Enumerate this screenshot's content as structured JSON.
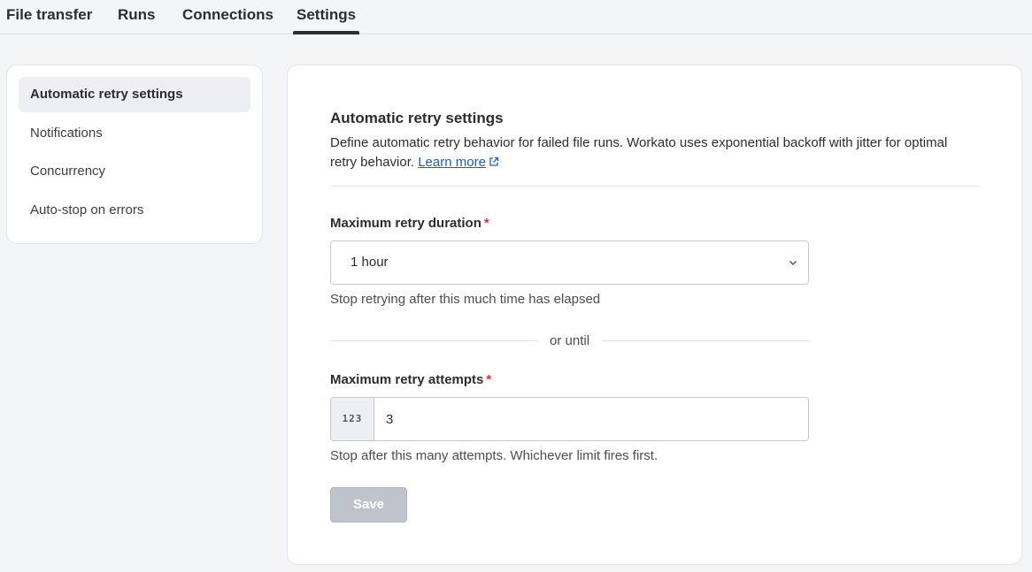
{
  "tabs": [
    {
      "label": "File transfer"
    },
    {
      "label": "Runs"
    },
    {
      "label": "Connections"
    },
    {
      "label": "Settings",
      "active": true
    }
  ],
  "sidebar": {
    "items": [
      {
        "label": "Automatic retry settings",
        "active": true
      },
      {
        "label": "Notifications"
      },
      {
        "label": "Concurrency"
      },
      {
        "label": "Auto-stop on errors"
      }
    ]
  },
  "panel": {
    "title": "Automatic retry settings",
    "description": "Define automatic retry behavior for failed file runs. Workato uses exponential backoff with jitter for optimal retry behavior.",
    "learn_more": "Learn more",
    "duration": {
      "label": "Maximum retry duration",
      "required_mark": "*",
      "value": "1 hour",
      "hint": "Stop retrying after this much time has elapsed"
    },
    "or_until": "or until",
    "attempts": {
      "label": "Maximum retry attempts",
      "required_mark": "*",
      "prefix": "123",
      "value": "3",
      "hint": "Stop after this many attempts. Whichever limit fires first."
    },
    "save_label": "Save"
  },
  "icons": {
    "external_link": "external-link-icon",
    "select_chevron": "chevron-down-icon"
  },
  "colors": {
    "link": "#1d5fbf",
    "required": "#d23b3b",
    "save_disabled": "#bfc3cb"
  }
}
